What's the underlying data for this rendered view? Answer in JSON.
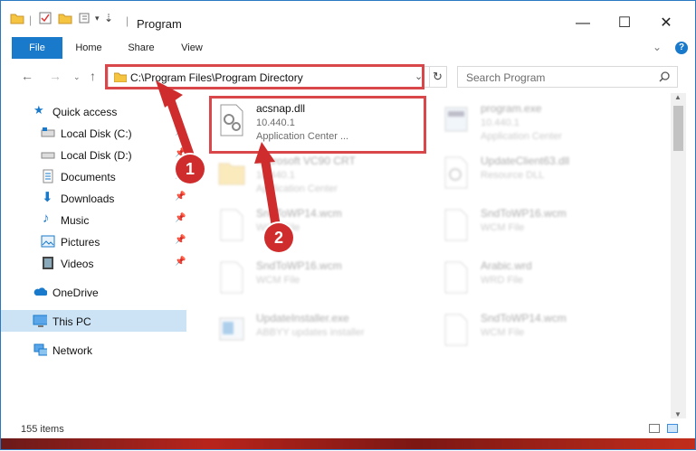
{
  "window": {
    "title": "Program"
  },
  "ribbon": {
    "tabs": [
      "File",
      "Home",
      "Share",
      "View"
    ]
  },
  "address": {
    "path": "C:\\Program Files\\Program Directory"
  },
  "search": {
    "placeholder": "Search Program"
  },
  "sidebar": {
    "quick_access": "Quick access",
    "items": [
      "Local Disk (C:)",
      "Local Disk (D:)",
      "Documents",
      "Downloads",
      "Music",
      "Pictures",
      "Videos"
    ],
    "onedrive": "OneDrive",
    "this_pc": "This PC",
    "network": "Network"
  },
  "files": [
    {
      "name": "acsnap.dll",
      "line1": "10.440.1",
      "line2": "Application Center ..."
    },
    {
      "name": "program.exe",
      "line1": "10.440.1",
      "line2": "Application Center"
    },
    {
      "name": "Microsoft VC90 CRT",
      "line1": "10.440.1",
      "line2": "Application Center"
    },
    {
      "name": "UpdateClient63.dll",
      "line1": "Resource DLL",
      "line2": ""
    },
    {
      "name": "SndToWP14.wcm",
      "line1": "WCM File",
      "line2": ""
    },
    {
      "name": "SndToWP16.wcm",
      "line1": "WCM File",
      "line2": ""
    },
    {
      "name": "SndToWP16.wcm",
      "line1": "WCM File",
      "line2": ""
    },
    {
      "name": "Arabic.wrd",
      "line1": "WRD File",
      "line2": ""
    },
    {
      "name": "UpdateInstaller.exe",
      "line1": "ABBYY updates installer",
      "line2": ""
    },
    {
      "name": "SndToWP14.wcm",
      "line1": "WCM File",
      "line2": ""
    }
  ],
  "status": {
    "count": "155 items"
  },
  "callouts": [
    "1",
    "2"
  ],
  "colors": {
    "accent": "#1979ca",
    "highlight": "#d9474b",
    "callout": "#cf2d2d"
  }
}
